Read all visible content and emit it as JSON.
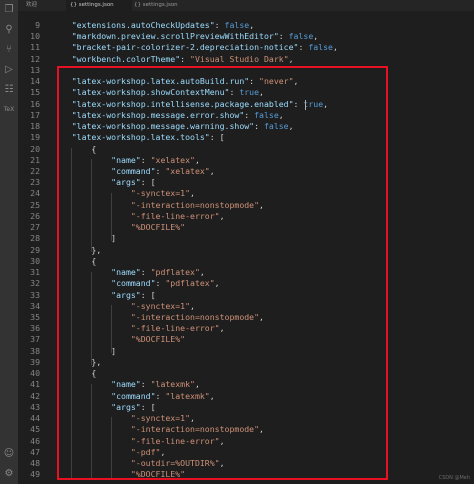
{
  "tabs": [
    {
      "label": "欢迎",
      "active": false
    },
    {
      "label": "{} settings.json",
      "active": true
    },
    {
      "label": "{} settings.json",
      "active": false
    }
  ],
  "activity_icons": [
    "files-icon",
    "search-icon",
    "source-control-icon",
    "run-debug-icon",
    "extensions-icon",
    "latex-icon",
    "accounts-icon",
    "settings-gear-icon"
  ],
  "activity_glyphs": [
    "❐",
    "⚲",
    "⑂",
    "▷",
    "☷",
    "TeX",
    "☺",
    "⚙"
  ],
  "lines": [
    {
      "n": "9",
      "html": [
        [
          "k",
          "    \"extensions.autoCheckUpdates\""
        ],
        [
          "p",
          ": "
        ],
        [
          "b",
          "false"
        ],
        [
          "p",
          ","
        ]
      ]
    },
    {
      "n": "10",
      "html": [
        [
          "k",
          "    \"markdown.preview.scrollPreviewWithEditor\""
        ],
        [
          "p",
          ": "
        ],
        [
          "b",
          "false"
        ],
        [
          "p",
          ","
        ]
      ]
    },
    {
      "n": "11",
      "html": [
        [
          "k",
          "    \"bracket-pair-colorizer-2.depreciation-notice\""
        ],
        [
          "p",
          ": "
        ],
        [
          "b",
          "false"
        ],
        [
          "p",
          ","
        ]
      ]
    },
    {
      "n": "12",
      "html": [
        [
          "k",
          "    \"workbench.colorTheme\""
        ],
        [
          "p",
          ": "
        ],
        [
          "s",
          "\"Visual Studio Dark\""
        ],
        [
          "p",
          ","
        ]
      ]
    },
    {
      "n": "13",
      "html": []
    },
    {
      "n": "14",
      "html": [
        [
          "k",
          "    \"latex-workshop.latex.autoBuild.run\""
        ],
        [
          "p",
          ": "
        ],
        [
          "s",
          "\"never\""
        ],
        [
          "p",
          ","
        ]
      ]
    },
    {
      "n": "15",
      "html": [
        [
          "k",
          "    \"latex-workshop.showContextMenu\""
        ],
        [
          "p",
          ": "
        ],
        [
          "b",
          "true"
        ],
        [
          "p",
          ","
        ]
      ]
    },
    {
      "n": "16",
      "html": [
        [
          "k",
          "    \"latex-workshop.intellisense.package.enabled\""
        ],
        [
          "p",
          ": "
        ],
        [
          "b",
          "true"
        ],
        [
          "p",
          ","
        ]
      ]
    },
    {
      "n": "17",
      "html": [
        [
          "k",
          "    \"latex-workshop.message.error.show\""
        ],
        [
          "p",
          ": "
        ],
        [
          "b",
          "false"
        ],
        [
          "p",
          ","
        ]
      ]
    },
    {
      "n": "18",
      "html": [
        [
          "k",
          "    \"latex-workshop.message.warning.show\""
        ],
        [
          "p",
          ": "
        ],
        [
          "b",
          "false"
        ],
        [
          "p",
          ","
        ]
      ]
    },
    {
      "n": "19",
      "html": [
        [
          "k",
          "    \"latex-workshop.latex.tools\""
        ],
        [
          "p",
          ": ["
        ]
      ]
    },
    {
      "n": "20",
      "html": [
        [
          "p",
          "        {"
        ]
      ]
    },
    {
      "n": "21",
      "html": [
        [
          "k",
          "            \"name\""
        ],
        [
          "p",
          ": "
        ],
        [
          "s",
          "\"xelatex\""
        ],
        [
          "p",
          ","
        ]
      ]
    },
    {
      "n": "22",
      "html": [
        [
          "k",
          "            \"command\""
        ],
        [
          "p",
          ": "
        ],
        [
          "s",
          "\"xelatex\""
        ],
        [
          "p",
          ","
        ]
      ]
    },
    {
      "n": "23",
      "html": [
        [
          "k",
          "            \"args\""
        ],
        [
          "p",
          ": ["
        ]
      ]
    },
    {
      "n": "24",
      "html": [
        [
          "s",
          "                \"-synctex=1\""
        ],
        [
          "p",
          ","
        ]
      ]
    },
    {
      "n": "25",
      "html": [
        [
          "s",
          "                \"-interaction=nonstopmode\""
        ],
        [
          "p",
          ","
        ]
      ]
    },
    {
      "n": "26",
      "html": [
        [
          "s",
          "                \"-file-line-error\""
        ],
        [
          "p",
          ","
        ]
      ]
    },
    {
      "n": "27",
      "html": [
        [
          "s",
          "                \"%DOCFILE%\""
        ]
      ]
    },
    {
      "n": "28",
      "html": [
        [
          "p",
          "            ]"
        ]
      ]
    },
    {
      "n": "29",
      "html": [
        [
          "p",
          "        },"
        ]
      ]
    },
    {
      "n": "30",
      "html": [
        [
          "p",
          "        {"
        ]
      ]
    },
    {
      "n": "31",
      "html": [
        [
          "k",
          "            \"name\""
        ],
        [
          "p",
          ": "
        ],
        [
          "s",
          "\"pdflatex\""
        ],
        [
          "p",
          ","
        ]
      ]
    },
    {
      "n": "32",
      "html": [
        [
          "k",
          "            \"command\""
        ],
        [
          "p",
          ": "
        ],
        [
          "s",
          "\"pdflatex\""
        ],
        [
          "p",
          ","
        ]
      ]
    },
    {
      "n": "33",
      "html": [
        [
          "k",
          "            \"args\""
        ],
        [
          "p",
          ": ["
        ]
      ]
    },
    {
      "n": "34",
      "html": [
        [
          "s",
          "                \"-synctex=1\""
        ],
        [
          "p",
          ","
        ]
      ]
    },
    {
      "n": "35",
      "html": [
        [
          "s",
          "                \"-interaction=nonstopmode\""
        ],
        [
          "p",
          ","
        ]
      ]
    },
    {
      "n": "36",
      "html": [
        [
          "s",
          "                \"-file-line-error\""
        ],
        [
          "p",
          ","
        ]
      ]
    },
    {
      "n": "37",
      "html": [
        [
          "s",
          "                \"%DOCFILE%\""
        ]
      ]
    },
    {
      "n": "38",
      "html": [
        [
          "p",
          "            ]"
        ]
      ]
    },
    {
      "n": "39",
      "html": [
        [
          "p",
          "        },"
        ]
      ]
    },
    {
      "n": "40",
      "html": [
        [
          "p",
          "        {"
        ]
      ]
    },
    {
      "n": "41",
      "html": [
        [
          "k",
          "            \"name\""
        ],
        [
          "p",
          ": "
        ],
        [
          "s",
          "\"latexmk\""
        ],
        [
          "p",
          ","
        ]
      ]
    },
    {
      "n": "42",
      "html": [
        [
          "k",
          "            \"command\""
        ],
        [
          "p",
          ": "
        ],
        [
          "s",
          "\"latexmk\""
        ],
        [
          "p",
          ","
        ]
      ]
    },
    {
      "n": "43",
      "html": [
        [
          "k",
          "            \"args\""
        ],
        [
          "p",
          ": ["
        ]
      ]
    },
    {
      "n": "44",
      "html": [
        [
          "s",
          "                \"-synctex=1\""
        ],
        [
          "p",
          ","
        ]
      ]
    },
    {
      "n": "45",
      "html": [
        [
          "s",
          "                \"-interaction=nonstopmode\""
        ],
        [
          "p",
          ","
        ]
      ]
    },
    {
      "n": "46",
      "html": [
        [
          "s",
          "                \"-file-line-error\""
        ],
        [
          "p",
          ","
        ]
      ]
    },
    {
      "n": "47",
      "html": [
        [
          "s",
          "                \"-pdf\""
        ],
        [
          "p",
          ","
        ]
      ]
    },
    {
      "n": "48",
      "html": [
        [
          "s",
          "                \"-outdir=%OUTDIR%\""
        ],
        [
          "p",
          ","
        ]
      ]
    },
    {
      "n": "49",
      "html": [
        [
          "s",
          "                \"%DOCFILE%\""
        ]
      ]
    }
  ],
  "watermark": "CSDN @Meh",
  "colors": {
    "key": "#9cdcfe",
    "string": "#ce9178",
    "boolean": "#569cd6",
    "highlight_border": "#e81123"
  }
}
